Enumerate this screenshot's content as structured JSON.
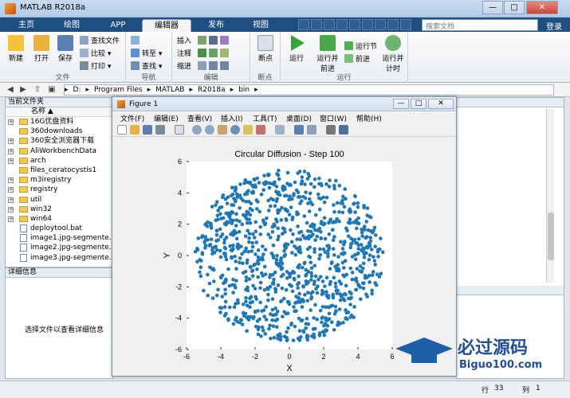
{
  "app": {
    "title": "MATLAB R2018a"
  },
  "window_controls": {
    "minimize": "—",
    "maximize": "□",
    "close": "✕"
  },
  "tabs": [
    "主页",
    "绘图",
    "APP",
    "编辑器",
    "发布",
    "视图"
  ],
  "search": {
    "placeholder": "搜索文档"
  },
  "signin": "登录",
  "ribbon": {
    "file_group": {
      "label": "文件",
      "new": "新建",
      "open": "打开",
      "save": "保存",
      "find_files": "查找文件",
      "compare": "比较",
      "print": "打印"
    },
    "nav_group": {
      "label": "导航",
      "goto": "转至",
      "find": "查找"
    },
    "edit_group": {
      "label": "编辑",
      "insert": "插入",
      "comment": "注释",
      "indent": "缩进"
    },
    "breakpoint_group": {
      "label": "断点",
      "breakpoints": "断点"
    },
    "run_group": {
      "label": "运行",
      "run": "运行",
      "run_advance": "运行并前进",
      "run_section": "运行节",
      "advance": "前进",
      "run_time": "运行并计时"
    }
  },
  "path": [
    "D:",
    "Program Files",
    "MATLAB",
    "R2018a",
    "bin"
  ],
  "file_panel": {
    "title": "当前文件夹",
    "column": "名称 ▲",
    "items": [
      {
        "name": "16G优盘资料",
        "type": "folder",
        "expand": true
      },
      {
        "name": "360downloads",
        "type": "folder",
        "expand": false
      },
      {
        "name": "360安全浏览器下载",
        "type": "folder",
        "expand": true
      },
      {
        "name": "AliWorkbenchData",
        "type": "folder",
        "expand": true
      },
      {
        "name": "arch",
        "type": "folder",
        "expand": true
      },
      {
        "name": "files_ceratocystis1",
        "type": "folder",
        "expand": false
      },
      {
        "name": "m3iregistry",
        "type": "folder",
        "expand": true
      },
      {
        "name": "registry",
        "type": "folder",
        "expand": true
      },
      {
        "name": "util",
        "type": "folder",
        "expand": true
      },
      {
        "name": "win32",
        "type": "folder",
        "expand": true
      },
      {
        "name": "win64",
        "type": "folder",
        "expand": true
      },
      {
        "name": "deploytool.bat",
        "type": "file",
        "expand": false
      },
      {
        "name": "image1.jpg-segmente...",
        "type": "file",
        "expand": false
      },
      {
        "name": "image2.jpg-segmente...",
        "type": "file",
        "expand": false
      },
      {
        "name": "image3.jpg-segmente...",
        "type": "file",
        "expand": false
      }
    ]
  },
  "detail_panel": {
    "title": "详细信息",
    "message": "选择文件以查看详细信息"
  },
  "status": {
    "row_label": "行",
    "row": "33",
    "col_label": "列",
    "col": "1"
  },
  "figure": {
    "title": "Figure 1",
    "menu": [
      "文件(F)",
      "编辑(E)",
      "查看(V)",
      "插入(I)",
      "工具(T)",
      "桌面(D)",
      "窗口(W)",
      "帮助(H)"
    ],
    "accent": "#1f77b4"
  },
  "watermark": {
    "title": "必过源码",
    "url": "Biguo100.com"
  },
  "chart_data": {
    "type": "scatter",
    "title": "Circular Diffusion - Step 100",
    "xlabel": "X",
    "ylabel": "Y",
    "xlim": [
      -6,
      6
    ],
    "ylim": [
      -6,
      6
    ],
    "xticks": [
      -6,
      -4,
      -2,
      0,
      2,
      4,
      6
    ],
    "yticks": [
      -6,
      -4,
      -2,
      0,
      2,
      4,
      6
    ],
    "n_points": 1000,
    "radius": 5.5,
    "color": "#1f77b4"
  }
}
